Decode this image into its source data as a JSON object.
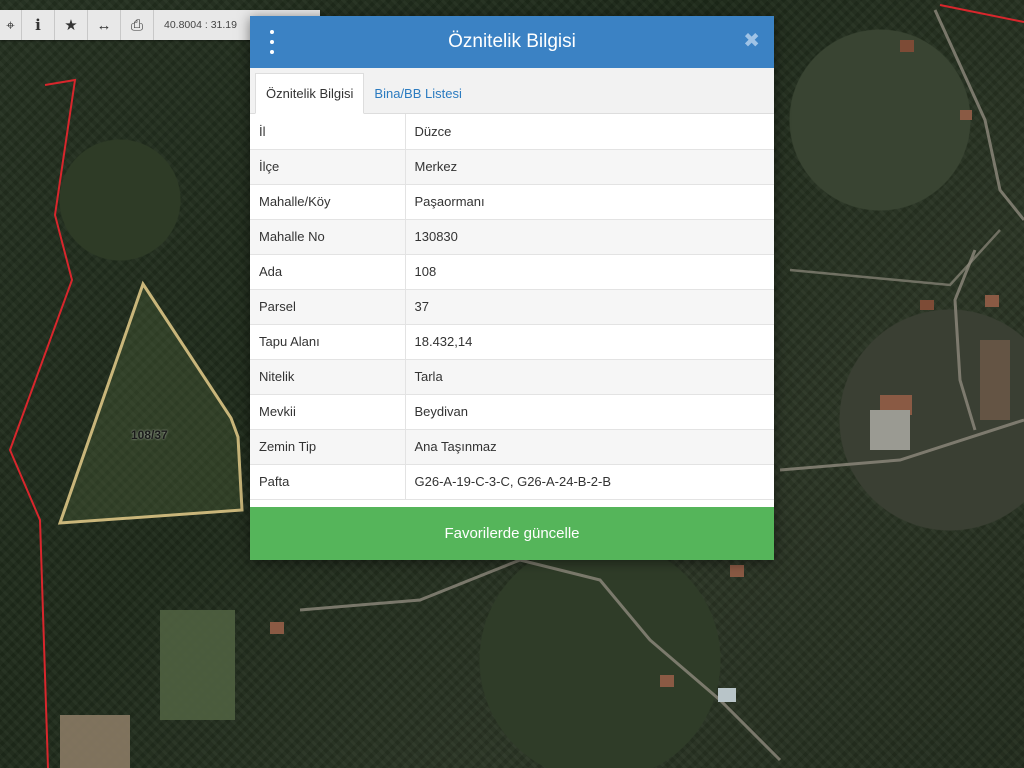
{
  "toolbar": {
    "buttons": [
      {
        "name": "crosshair-icon",
        "glyph": "⌖"
      },
      {
        "name": "info-icon",
        "glyph": "i"
      },
      {
        "name": "star-icon",
        "glyph": "★"
      },
      {
        "name": "measure-icon",
        "glyph": "↔"
      },
      {
        "name": "print-icon",
        "glyph": "⎙"
      }
    ],
    "coordinates": "40.8004 : 31.19"
  },
  "map": {
    "parcel_label": "108/37",
    "parcel_outline_color": "#c9b67a",
    "boundary_color": "#d8262c"
  },
  "dialog": {
    "title": "Öznitelik Bilgisi",
    "close_glyph": "✖",
    "tabs": [
      {
        "label": "Öznitelik Bilgisi",
        "active": true
      },
      {
        "label": "Bina/BB Listesi",
        "active": false
      }
    ],
    "rows": [
      {
        "key": "İl",
        "value": "Düzce"
      },
      {
        "key": "İlçe",
        "value": "Merkez"
      },
      {
        "key": "Mahalle/Köy",
        "value": "Paşaormanı"
      },
      {
        "key": "Mahalle No",
        "value": "130830"
      },
      {
        "key": "Ada",
        "value": "108"
      },
      {
        "key": "Parsel",
        "value": "37"
      },
      {
        "key": "Tapu Alanı",
        "value": "18.432,14"
      },
      {
        "key": "Nitelik",
        "value": "Tarla"
      },
      {
        "key": "Mevkii",
        "value": "Beydivan"
      },
      {
        "key": "Zemin Tip",
        "value": "Ana Taşınmaz"
      },
      {
        "key": "Pafta",
        "value": "G26-A-19-C-3-C, G26-A-24-B-2-B"
      }
    ],
    "save_label": "Favorilerde güncelle",
    "header_color": "#3b82c4",
    "save_color": "#55b55a"
  }
}
